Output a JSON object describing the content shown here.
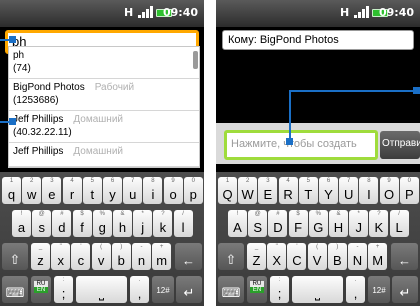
{
  "status_bar": {
    "time": "09:40",
    "network": "H"
  },
  "left_screen": {
    "search_text": "ph",
    "suggestions": [
      {
        "name": "ph",
        "number": "(74)",
        "type": ""
      },
      {
        "name": "BigPond Photos",
        "number": "(1253686)",
        "type": "Рабочий"
      },
      {
        "name": "Jeff Phillips",
        "number": "(40.32.22.11)",
        "type": "Домашний"
      },
      {
        "name": "Jeff Phillips",
        "number": "",
        "type": "Домашний"
      }
    ]
  },
  "right_screen": {
    "to_field": "Кому: BigPond Photos",
    "message_placeholder": "Нажмите, чтобы создать",
    "send_label": "Отправить"
  },
  "keyboard_left": {
    "row1": [
      [
        "q",
        "1"
      ],
      [
        "w",
        "2"
      ],
      [
        "e",
        "3"
      ],
      [
        "r",
        "4"
      ],
      [
        "t",
        "5"
      ],
      [
        "y",
        "6"
      ],
      [
        "u",
        "7"
      ],
      [
        "i",
        "8"
      ],
      [
        "o",
        "9"
      ],
      [
        "p",
        "0"
      ]
    ],
    "row2": [
      [
        "a",
        "!"
      ],
      [
        "s",
        "@"
      ],
      [
        "d",
        "#"
      ],
      [
        "f",
        "$"
      ],
      [
        "g",
        "%"
      ],
      [
        "h",
        "&"
      ],
      [
        "j",
        "*"
      ],
      [
        "k",
        "?"
      ],
      [
        "l",
        "/"
      ]
    ],
    "row3": [
      [
        "z",
        "_"
      ],
      [
        "x",
        "\""
      ],
      [
        "c",
        "'"
      ],
      [
        "v",
        "("
      ],
      [
        "b",
        ")"
      ],
      [
        "n",
        "-"
      ],
      [
        "m",
        "+"
      ]
    ]
  },
  "keyboard_right": {
    "row1": [
      [
        "Q",
        "1"
      ],
      [
        "W",
        "2"
      ],
      [
        "E",
        "3"
      ],
      [
        "R",
        "4"
      ],
      [
        "T",
        "5"
      ],
      [
        "Y",
        "6"
      ],
      [
        "U",
        "7"
      ],
      [
        "I",
        "8"
      ],
      [
        "O",
        "9"
      ],
      [
        "P",
        "0"
      ]
    ],
    "row2": [
      [
        "A",
        "!"
      ],
      [
        "S",
        "@"
      ],
      [
        "D",
        "#"
      ],
      [
        "F",
        "$"
      ],
      [
        "G",
        "%"
      ],
      [
        "H",
        "&"
      ],
      [
        "J",
        "*"
      ],
      [
        "K",
        "?"
      ],
      [
        "L",
        "/"
      ]
    ],
    "row3": [
      [
        "Z",
        "_"
      ],
      [
        "X",
        "\""
      ],
      [
        "C",
        "'"
      ],
      [
        "V",
        "("
      ],
      [
        "B",
        ")"
      ],
      [
        "N",
        "-"
      ],
      [
        "M",
        "+"
      ]
    ]
  },
  "keyboard_common": {
    "lang_ru": "RU",
    "lang_en": "EN",
    "symbols_key": "12#",
    "punct_key": ";",
    "punct_alt": ":",
    "comma_key": ",",
    "comma_alt": "."
  },
  "icons": {
    "shift": "up-arrow",
    "backspace": "left-arrow",
    "enter": "return-arrow",
    "settings": "keyboard-icon",
    "space": "space-icon"
  },
  "colors": {
    "focus_orange": "#ffa800",
    "focus_green": "#9fdc3c",
    "callout_blue": "#1a6fc6",
    "battery_green": "#2ec02e"
  }
}
